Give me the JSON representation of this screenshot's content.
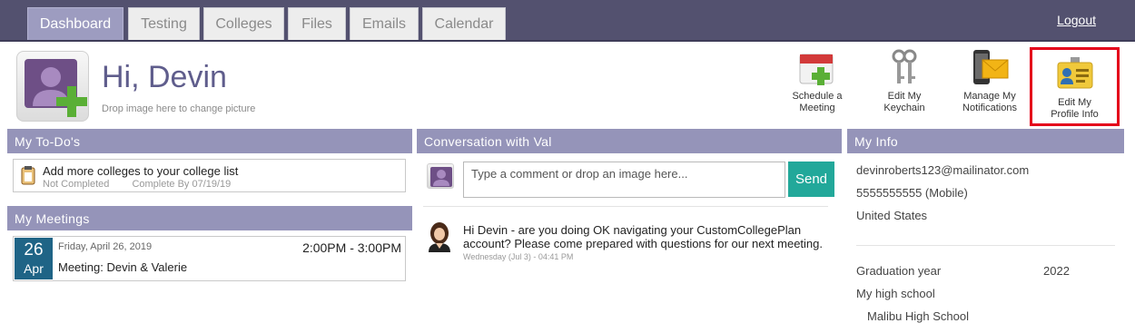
{
  "nav": {
    "tabs": [
      {
        "label": "Dashboard"
      },
      {
        "label": "Testing"
      },
      {
        "label": "Colleges"
      },
      {
        "label": "Files"
      },
      {
        "label": "Emails"
      },
      {
        "label": "Calendar"
      }
    ],
    "active_tab": "Dashboard",
    "logout_label": "Logout"
  },
  "header": {
    "greeting": "Hi, Devin",
    "drop_hint": "Drop image here to change picture"
  },
  "actions": [
    {
      "label_line1": "Schedule a",
      "label_line2": "Meeting",
      "icon": "calendar-plus-icon"
    },
    {
      "label_line1": "Edit My",
      "label_line2": "Keychain",
      "icon": "keys-icon"
    },
    {
      "label_line1": "Manage My",
      "label_line2": "Notifications",
      "icon": "phone-mail-icon"
    },
    {
      "label_line1": "Edit My",
      "label_line2": "Profile Info",
      "icon": "id-card-icon",
      "highlighted": true
    }
  ],
  "todos": {
    "title": "My To-Do's",
    "items": [
      {
        "title": "Add more colleges to your college list",
        "status": "Not Completed",
        "due": "Complete By 07/19/19"
      }
    ]
  },
  "meetings": {
    "title": "My Meetings",
    "items": [
      {
        "day": "26",
        "month": "Apr",
        "date_text": "Friday, April 26, 2019",
        "time": "2:00PM - 3:00PM",
        "title": "Meeting: Devin & Valerie"
      }
    ]
  },
  "conversation": {
    "title": "Conversation with Val",
    "comment_placeholder": "Type a comment or drop an image here...",
    "send_label": "Send",
    "messages": [
      {
        "text": "Hi Devin - are you doing OK navigating your CustomCollegePlan account? Please come prepared with questions for our next meeting.",
        "time": "Wednesday (Jul 3) - 04:41 PM"
      }
    ]
  },
  "my_info": {
    "title": "My Info",
    "email": "devinroberts123@mailinator.com",
    "phone": "5555555555 (Mobile)",
    "country": "United States",
    "grad_label": "Graduation year",
    "grad_value": "2022",
    "school_label": "My high school",
    "school_value": "Malibu High School"
  },
  "colors": {
    "nav_bg": "#53516f",
    "panel_header": "#9594b9",
    "accent_send": "#22a89a",
    "date_badge": "#1f6486",
    "highlight": "#e4001b"
  }
}
